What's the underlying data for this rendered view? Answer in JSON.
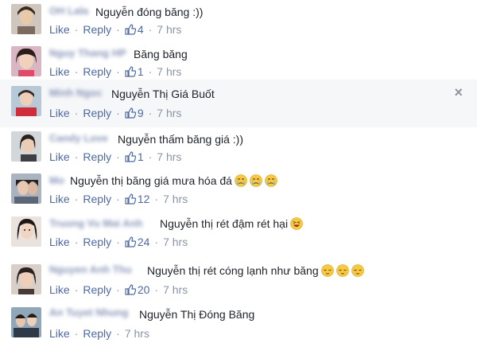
{
  "actions": {
    "like": "Like",
    "reply": "Reply",
    "dot": "·"
  },
  "comments": [
    {
      "author": "OH Lala",
      "text": "Nguyễn đóng băng :))",
      "likes": "4",
      "time": "7 hrs",
      "emoji": []
    },
    {
      "author": "Nguy Thang HP",
      "text": "Băng băng",
      "likes": "1",
      "time": "7 hrs",
      "emoji": []
    },
    {
      "author": "Minh Ngoc",
      "text": "Nguyễn Thị Giá Buốt",
      "likes": "9",
      "time": "7 hrs",
      "emoji": []
    },
    {
      "author": "Candy Love",
      "text": "Nguyễn thấm băng giá :))",
      "likes": "1",
      "time": "7 hrs",
      "emoji": []
    },
    {
      "author": "Mo",
      "text": "Nguyễn thị băng giá mưa hóa đá",
      "likes": "12",
      "time": "7 hrs",
      "emoji": [
        "crying-face-icon",
        "crying-face-icon",
        "crying-face-icon"
      ]
    },
    {
      "author": "Truong Vu Mai Anh",
      "text": "Nguyễn thị rét đậm rét hại",
      "likes": "24",
      "time": "7 hrs",
      "emoji": [
        "laughing-face-icon"
      ]
    },
    {
      "author": "Nguyen Anh Thu",
      "text": "Nguyễn thị rét cóng lạnh như băng",
      "likes": "20",
      "time": "7 hrs",
      "emoji": [
        "relieved-face-icon",
        "relieved-face-icon",
        "relieved-face-icon"
      ]
    },
    {
      "author": "An Tuyet Nhung",
      "text": "Nguyễn Thị Đóng Băng",
      "likes": "",
      "time": "7 hrs",
      "emoji": []
    }
  ],
  "close_label": "×",
  "colors": {
    "link": "#4e69a2",
    "meta": "#8b94a3",
    "highlight_bg": "#f6f7f9",
    "author_blur": "#8a97b8"
  }
}
